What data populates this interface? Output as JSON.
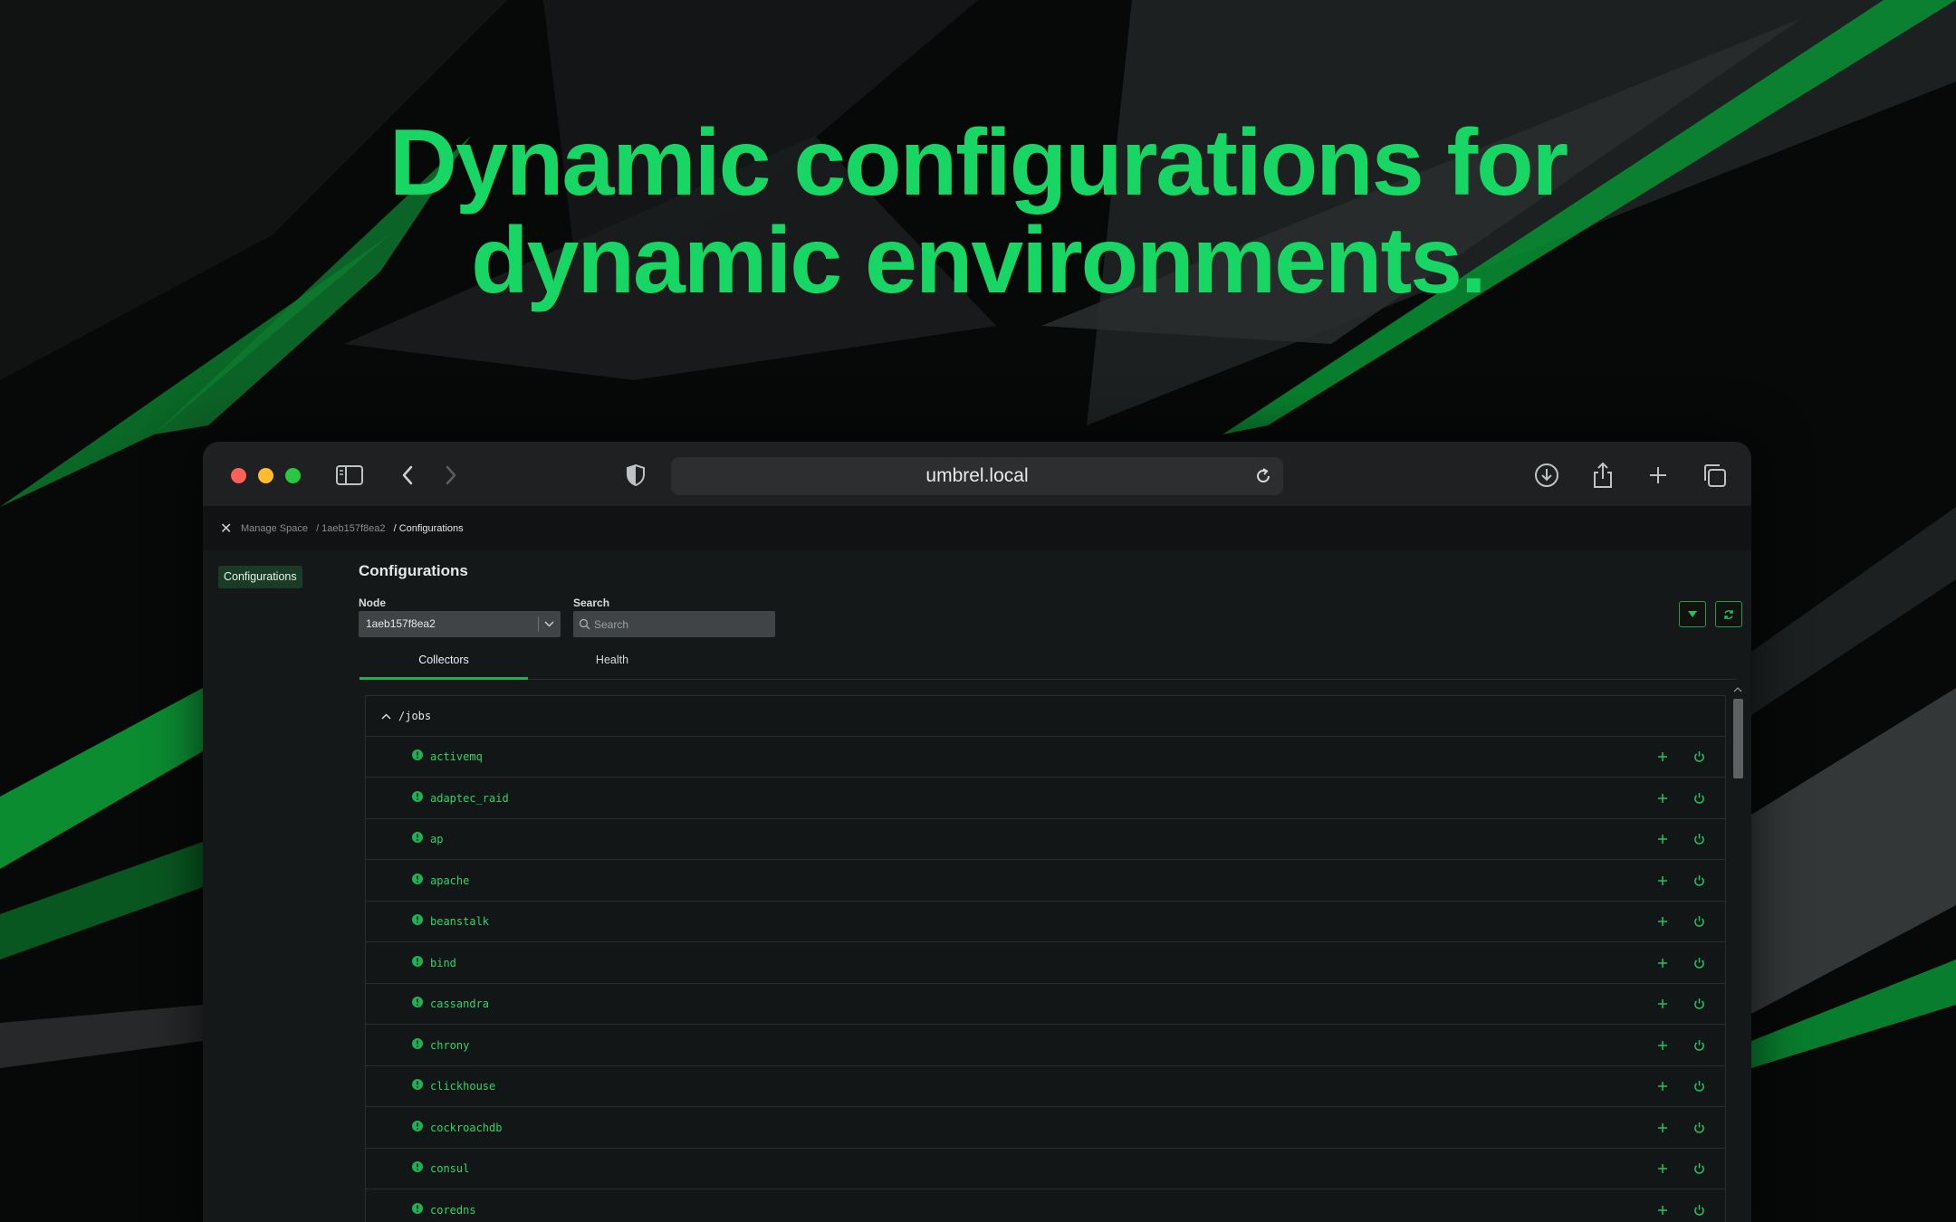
{
  "headline": {
    "line1": "Dynamic configurations for",
    "line2": "dynamic environments."
  },
  "browser": {
    "url": "umbrel.local"
  },
  "breadcrumb": {
    "items": [
      "Manage Space",
      "/ 1aeb157f8ea2",
      "/ Configurations"
    ]
  },
  "sidebar": {
    "items": [
      {
        "label": "Configurations",
        "active": true
      }
    ]
  },
  "main": {
    "title": "Configurations",
    "node_label": "Node",
    "node_value": "1aeb157f8ea2",
    "search_label": "Search",
    "search_placeholder": "Search",
    "tabs": [
      {
        "label": "Collectors",
        "active": true
      },
      {
        "label": "Health",
        "active": false
      }
    ],
    "tree": {
      "root": "/jobs",
      "items": [
        "activemq",
        "adaptec_raid",
        "ap",
        "apache",
        "beanstalk",
        "bind",
        "cassandra",
        "chrony",
        "clickhouse",
        "cockroachdb",
        "consul",
        "coredns"
      ]
    }
  },
  "colors": {
    "accent": "#17d664",
    "row_text": "#2dd56a",
    "window_bg": "#151819"
  }
}
